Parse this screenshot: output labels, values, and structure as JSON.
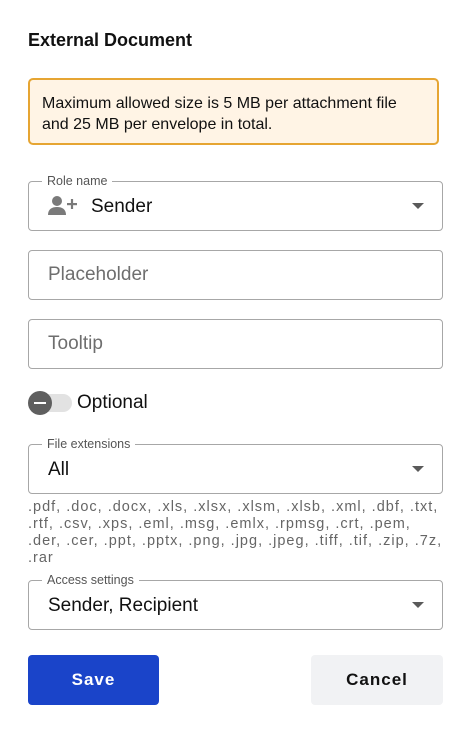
{
  "dialog": {
    "title": "External Document"
  },
  "alert": {
    "text": "Maximum allowed size is 5 MB per attachment file and 25 MB per envelope in total."
  },
  "role": {
    "label": "Role name",
    "value": "Sender",
    "icon": "person-add-icon"
  },
  "placeholder_field": {
    "placeholder": "Placeholder"
  },
  "tooltip_field": {
    "placeholder": "Tooltip"
  },
  "optional": {
    "label": "Optional",
    "enabled": false
  },
  "file_extensions": {
    "label": "File extensions",
    "value": "All",
    "list": ".pdf, .doc, .docx, .xls, .xlsx, .xlsm, .xlsb, .xml, .dbf, .txt, .rtf, .csv, .xps, .eml, .msg, .emlx, .rpmsg, .crt, .pem, .der, .cer, .ppt, .pptx, .png, .jpg, .jpeg, .tiff, .tif, .zip, .7z, .rar"
  },
  "access": {
    "label": "Access settings",
    "value": "Sender, Recipient"
  },
  "actions": {
    "save_label": "Save",
    "cancel_label": "Cancel"
  },
  "colors": {
    "primary": "#1a44c9",
    "alert_border": "#e6a532",
    "alert_background": "#fff4e5"
  }
}
